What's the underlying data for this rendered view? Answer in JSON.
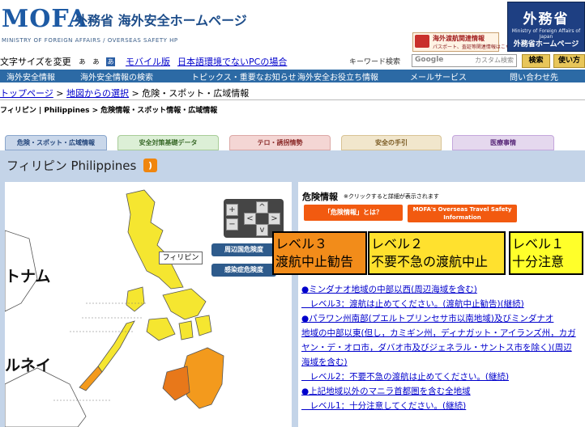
{
  "header": {
    "logo_text": "MOFA",
    "logo_jp": "外務省 海外安全ホームページ",
    "logo_sub": "MINISTRY OF FOREIGN AFFAIRS / OVERSEAS SAFETY HP",
    "notice_title": "海外渡航関連情報",
    "notice_sub": "パスポート、査証等関連情報はこちら",
    "mofa_title": "外務省",
    "mofa_sub": "Ministry of Foreign Affairs of Japan",
    "mofa_hp": "外務省ホームページ"
  },
  "util": {
    "fontsize_label": "文字サイズを変更",
    "fs_small": "あ",
    "fs_medium": "あ",
    "fs_large": "あ",
    "mobile": "モバイル版",
    "env": "日本語環境でないPCの場合",
    "keyword_label": "キーワード検索",
    "search_google": "Google",
    "search_custom": "カスタム検索",
    "search_button": "検索",
    "howto_button": "使い方"
  },
  "nav": {
    "items": [
      "海外安全情報",
      "海外安全情報の検索",
      "トピックス・重要なお知らせ",
      "海外安全お役立ち情報",
      "メールサービス",
      "問い合わせ先"
    ]
  },
  "breadcrumb": {
    "top": "トップページ",
    "sep1": " > ",
    "map": "地図からの選択",
    "sep2": " > ",
    "current": "危険・スポット・広域情報"
  },
  "location": "フィリピン | Philippines > 危険情報・スポット情報・広域情報",
  "tabs": [
    "危険・スポット・広域情報",
    "安全対策基礎データ",
    "テロ・誘拐情勢",
    "安全の手引",
    "医療事情"
  ],
  "country_title": "フィリピン  Philippines",
  "rss": ")",
  "map": {
    "label_ph": "フィリピン",
    "label_vn": "トナム",
    "label_bn": "ルネイ",
    "btn_neighbors": "周辺国危険度",
    "btn_infection": "感染症危険度",
    "ctrl_plus": "+",
    "ctrl_minus": "−",
    "ctrl_up": "^",
    "ctrl_left": "<",
    "ctrl_right": ">",
    "ctrl_down": "v"
  },
  "info": {
    "title": "危険情報",
    "note": "※クリックすると詳細が表示されます",
    "btn_what": "「危険情報」とは？",
    "btn_otsh_1": "MOFA's Overseas Travel Safety",
    "btn_otsh_2": "Information",
    "levels": [
      {
        "line1": "レベル３",
        "line2": "渡航中止勧告"
      },
      {
        "line1": "レベル２",
        "line2": "不要不急の渡航中止"
      },
      {
        "line1": "レベル１",
        "line2": "十分注意"
      }
    ],
    "details": [
      "●ミンダナオ地域の中部以西(周辺海域を含む)",
      "　レベル3：渡航は止めてください。(渡航中止勧告)(継続)",
      "●パラワン州南部(プエルトプリンセサ市以南地域)及びミンダナオ",
      "地域の中部以東(但し，カミギン州，ディナガット・アイランズ州，カガ",
      "ヤン・デ・オロ市，ダバオ市及びジェネラル・サントス市を除く)(周辺",
      "海域を含む)",
      "　レベル2：不要不急の渡航は止めてください。(継続)",
      "●上記地域以外のマニラ首都圏を含む全地域",
      "　レベル1：十分注意してください。(継続)"
    ]
  },
  "colors": {
    "nav": "#2c6aa5",
    "level3": "#f28c1a",
    "level2": "#ffe12e",
    "level1": "#ffff2a",
    "map_yellow": "#f5e630",
    "map_orange": "#f39a1d"
  }
}
